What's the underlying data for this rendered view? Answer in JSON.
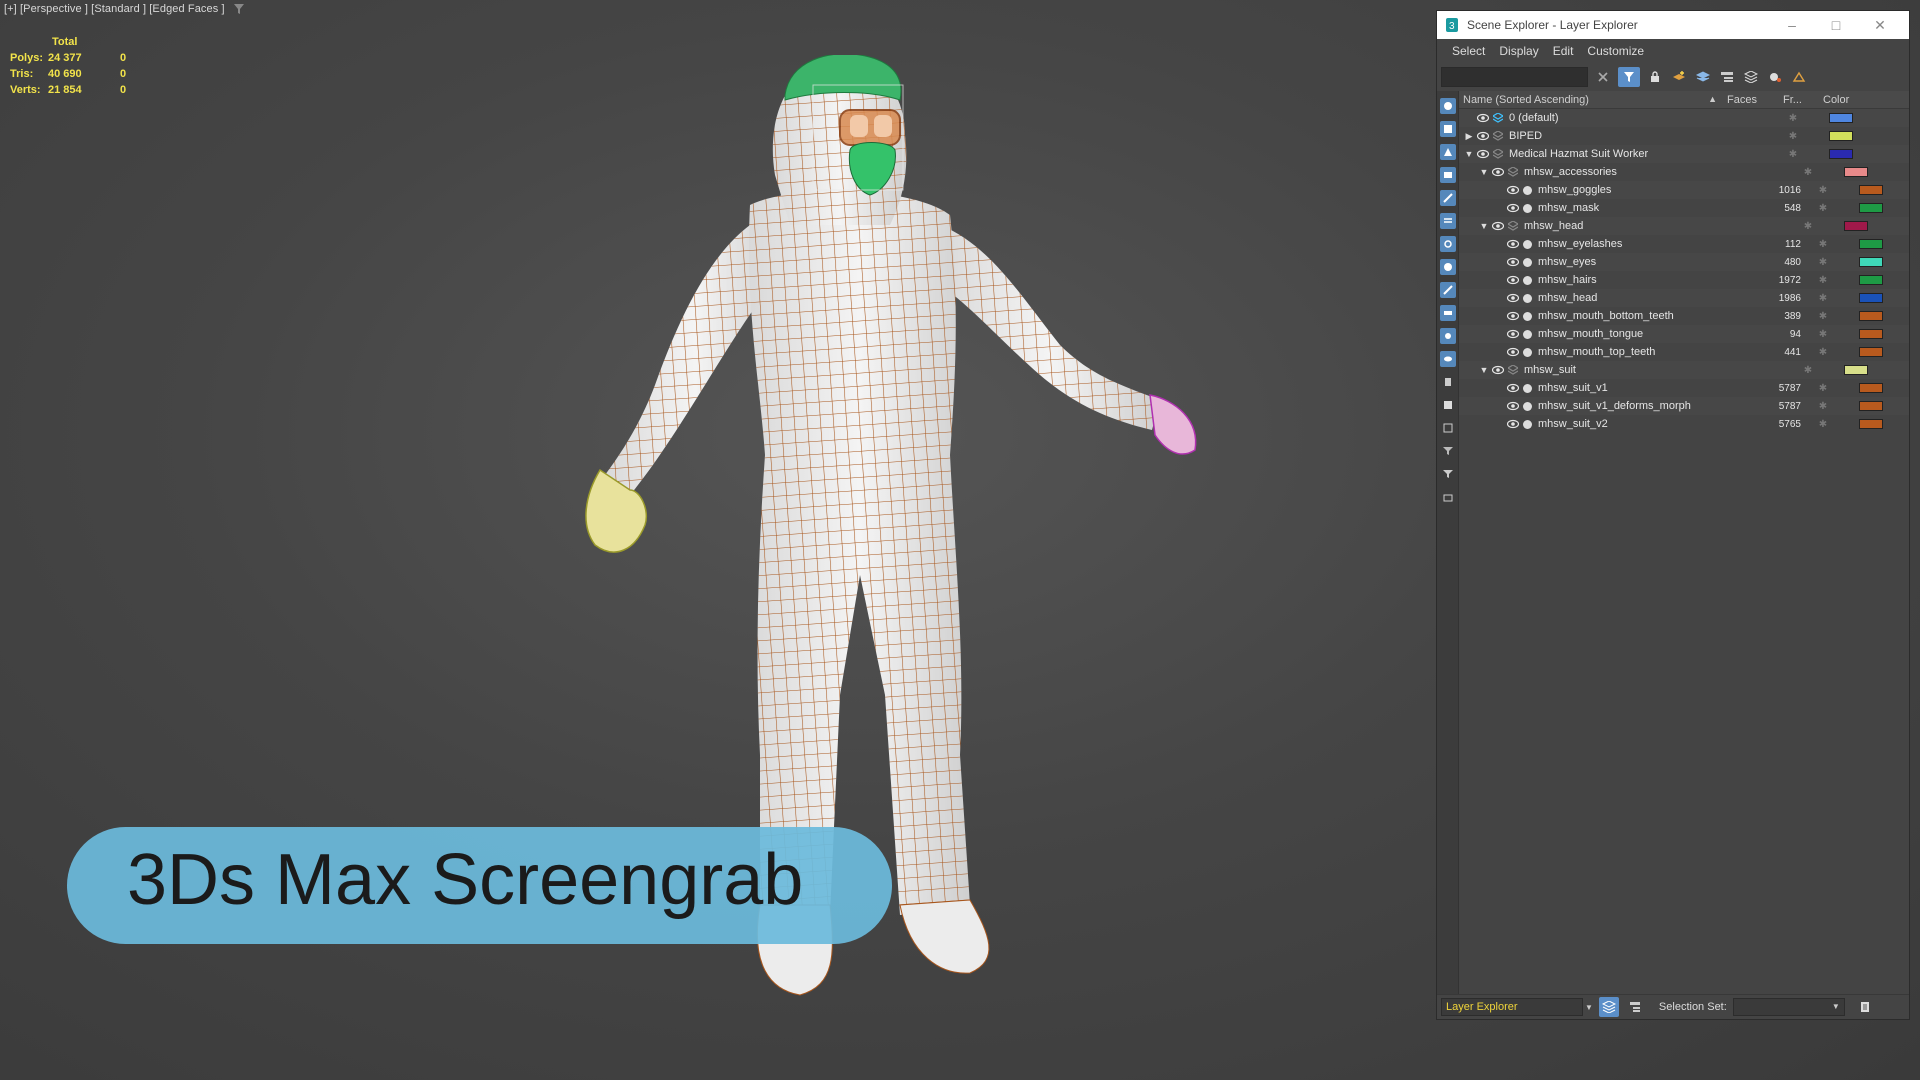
{
  "viewport": {
    "label": "[+] [Perspective ] [Standard ] [Edged Faces ]",
    "stats": {
      "header": "Total",
      "rows": [
        {
          "key": "Polys:",
          "total": "24 377",
          "selected": "0"
        },
        {
          "key": "Tris:",
          "total": "40 690",
          "selected": "0"
        },
        {
          "key": "Verts:",
          "total": "21 854",
          "selected": "0"
        }
      ]
    }
  },
  "banner": {
    "text": "3Ds Max Screengrab"
  },
  "explorer": {
    "title": "Scene Explorer - Layer Explorer",
    "menu": [
      "Select",
      "Display",
      "Edit",
      "Customize"
    ],
    "search_value": "",
    "columns": {
      "name": "Name (Sorted Ascending)",
      "sort_arrow": "▲",
      "faces": "Faces",
      "frozen": "Fr...",
      "color": "Color"
    },
    "rows": [
      {
        "name": "0 (default)",
        "faces": "",
        "depth": 0,
        "expander": "",
        "type": "default",
        "color": "#4f86e0"
      },
      {
        "name": "BIPED",
        "faces": "",
        "depth": 0,
        "expander": "▶",
        "type": "layer",
        "color": "#d2df5c"
      },
      {
        "name": "Medical Hazmat Suit Worker",
        "faces": "",
        "depth": 0,
        "expander": "▼",
        "type": "layer",
        "color": "#2a2ab0"
      },
      {
        "name": "mhsw_accessories",
        "faces": "",
        "depth": 1,
        "expander": "▼",
        "type": "layer",
        "color": "#e88a8a"
      },
      {
        "name": "mhsw_goggles",
        "faces": "1016",
        "depth": 2,
        "expander": "",
        "type": "object",
        "color": "#b85a1e"
      },
      {
        "name": "mhsw_mask",
        "faces": "548",
        "depth": 2,
        "expander": "",
        "type": "object",
        "color": "#1e9a45"
      },
      {
        "name": "mhsw_head",
        "faces": "",
        "depth": 1,
        "expander": "▼",
        "type": "layer",
        "color": "#a0194a"
      },
      {
        "name": "mhsw_eyelashes",
        "faces": "112",
        "depth": 2,
        "expander": "",
        "type": "object",
        "color": "#1e9a45"
      },
      {
        "name": "mhsw_eyes",
        "faces": "480",
        "depth": 2,
        "expander": "",
        "type": "object",
        "color": "#3fd8b8"
      },
      {
        "name": "mhsw_hairs",
        "faces": "1972",
        "depth": 2,
        "expander": "",
        "type": "object",
        "color": "#1e9a45"
      },
      {
        "name": "mhsw_head",
        "faces": "1986",
        "depth": 2,
        "expander": "",
        "type": "object",
        "color": "#1a52b8"
      },
      {
        "name": "mhsw_mouth_bottom_teeth",
        "faces": "389",
        "depth": 2,
        "expander": "",
        "type": "object",
        "color": "#b85a1e"
      },
      {
        "name": "mhsw_mouth_tongue",
        "faces": "94",
        "depth": 2,
        "expander": "",
        "type": "object",
        "color": "#b85a1e"
      },
      {
        "name": "mhsw_mouth_top_teeth",
        "faces": "441",
        "depth": 2,
        "expander": "",
        "type": "object",
        "color": "#b85a1e"
      },
      {
        "name": "mhsw_suit",
        "faces": "",
        "depth": 1,
        "expander": "▼",
        "type": "layer",
        "color": "#d8df8a"
      },
      {
        "name": "mhsw_suit_v1",
        "faces": "5787",
        "depth": 2,
        "expander": "",
        "type": "object",
        "color": "#b85a1e"
      },
      {
        "name": "mhsw_suit_v1_deforms_morph",
        "faces": "5787",
        "depth": 2,
        "expander": "",
        "type": "object",
        "color": "#b85a1e"
      },
      {
        "name": "mhsw_suit_v2",
        "faces": "5765",
        "depth": 2,
        "expander": "",
        "type": "object",
        "color": "#b85a1e"
      }
    ],
    "status": {
      "mode": "Layer Explorer",
      "selection_set_label": "Selection Set:",
      "selection_set_value": ""
    }
  }
}
